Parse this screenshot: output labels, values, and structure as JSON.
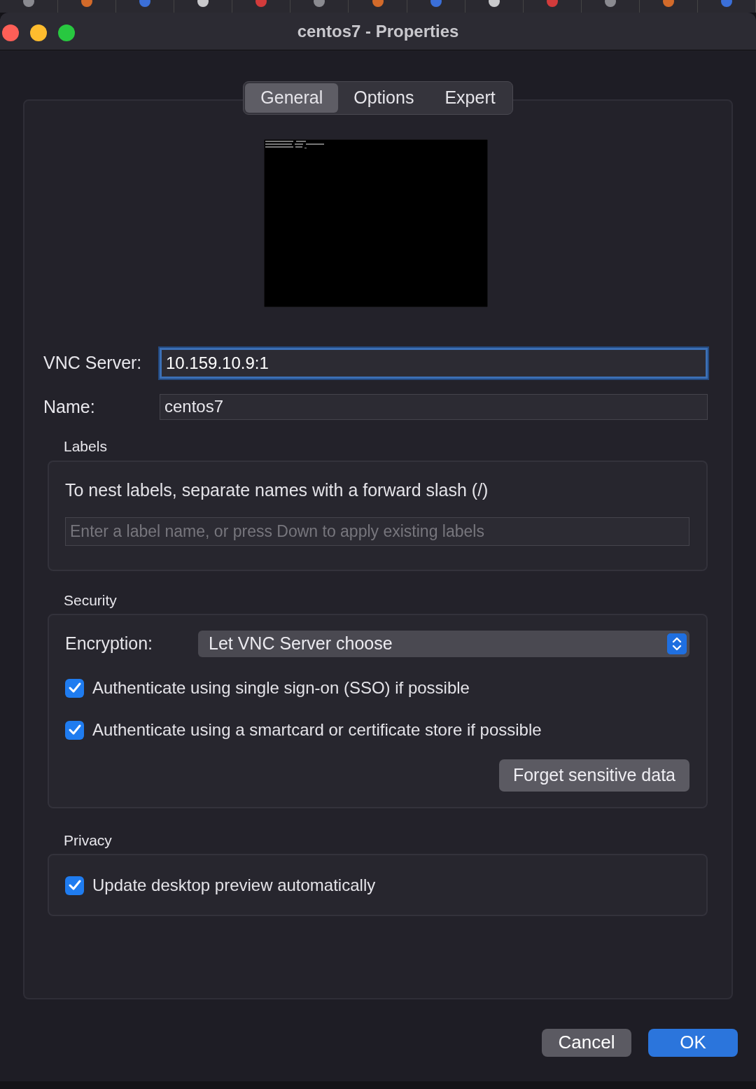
{
  "window": {
    "title": "centos7 - Properties"
  },
  "tabs": [
    {
      "label": "General",
      "selected": true
    },
    {
      "label": "Options",
      "selected": false
    },
    {
      "label": "Expert",
      "selected": false
    }
  ],
  "fields": [
    {
      "label": "VNC Server:",
      "value": "10.159.10.9:1",
      "focused": true
    },
    {
      "label": "Name:",
      "value": "centos7",
      "focused": false
    }
  ],
  "labels": {
    "title": "Labels",
    "hint": "To nest labels, separate names with a forward slash (/)",
    "placeholder": "Enter a label name, or press Down to apply existing labels"
  },
  "security": {
    "title": "Security",
    "encryption_label": "Encryption:",
    "encryption_value": "Let VNC Server choose",
    "options": [
      {
        "label": "Authenticate using single sign-on (SSO) if possible",
        "checked": true
      },
      {
        "label": "Authenticate using a smartcard or certificate store if possible",
        "checked": true
      }
    ],
    "forget_button": "Forget sensitive data"
  },
  "privacy": {
    "title": "Privacy",
    "options": [
      {
        "label": "Update desktop preview automatically",
        "checked": true
      }
    ]
  },
  "buttons": [
    {
      "label": "Cancel",
      "kind": "secondary"
    },
    {
      "label": "OK",
      "kind": "primary"
    }
  ]
}
